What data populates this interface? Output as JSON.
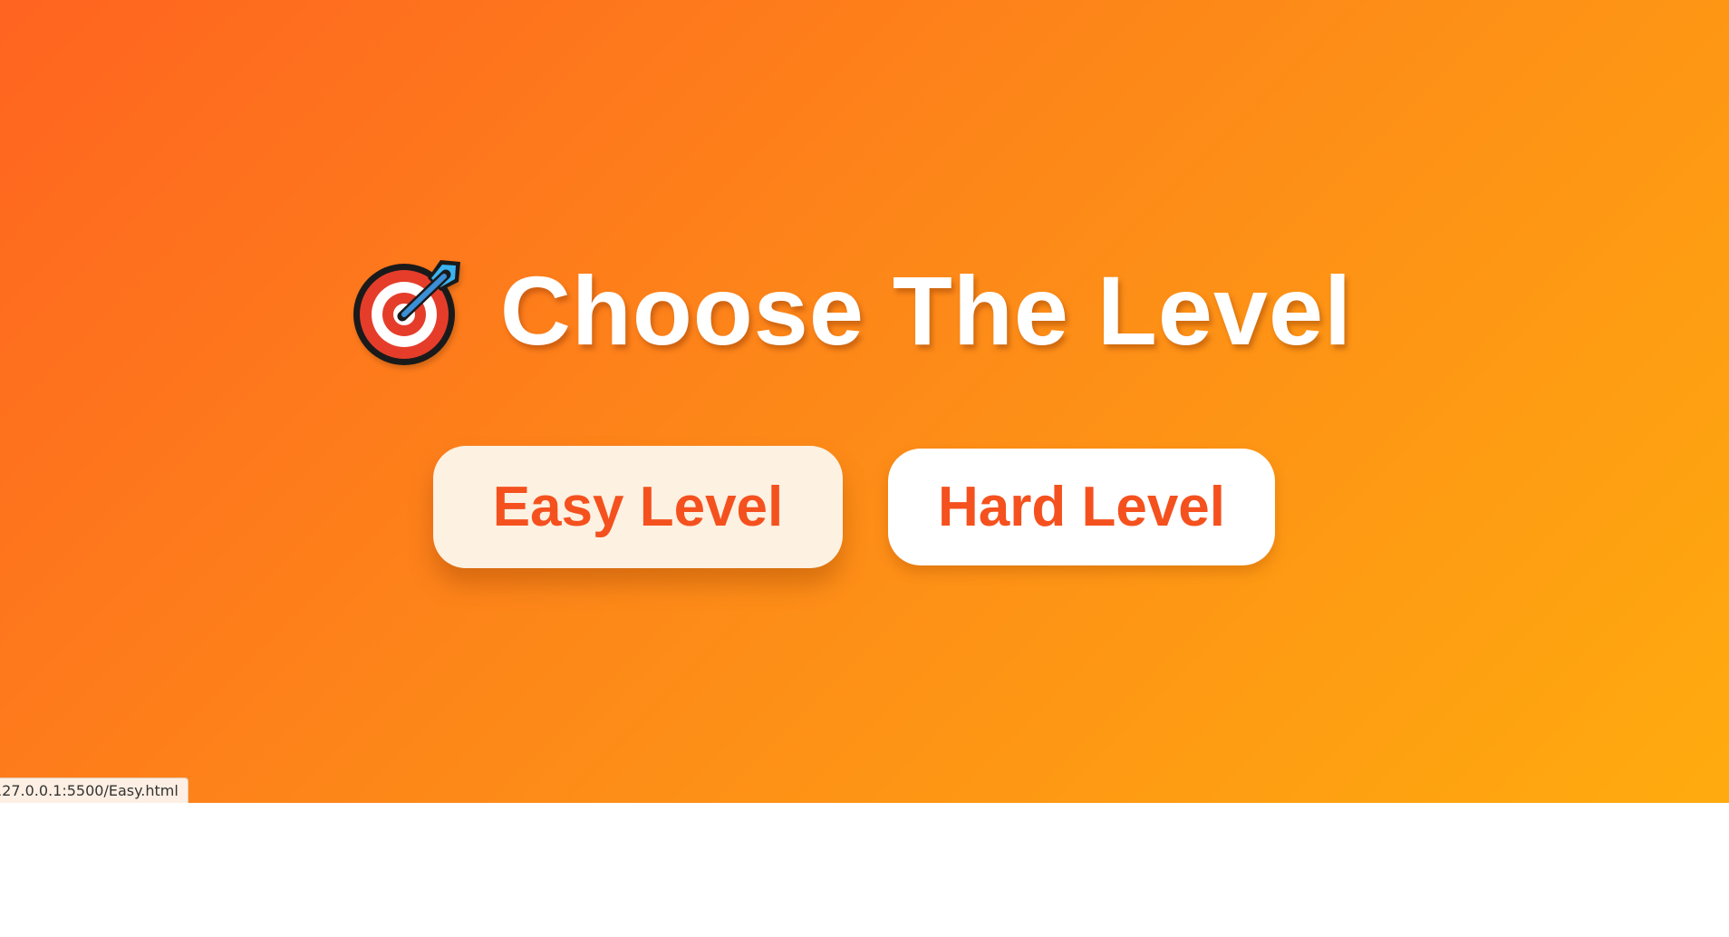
{
  "page": {
    "title_icon": "direct-hit-target-icon",
    "title": "Choose The Level"
  },
  "buttons": {
    "easy_label": "Easy Level",
    "hard_label": "Hard Level"
  },
  "status_bar": {
    "url": "127.0.0.1:5500/Easy.html"
  },
  "colors": {
    "background_gradient_start": "#ff6420",
    "background_gradient_end": "#ffab0e",
    "button_text": "#f4511e",
    "easy_button_bg_hover": "#fdf1e2",
    "hard_button_bg": "#ffffff",
    "title_text": "#ffffff"
  }
}
